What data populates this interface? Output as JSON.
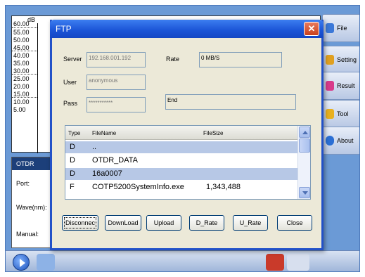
{
  "background": {
    "y_axis": {
      "unit": "dB",
      "ticks": [
        "60.00",
        "55.00",
        "50.00",
        "45.00",
        "40.00",
        "35.00",
        "30.00",
        "25.00",
        "20.00",
        "15.00",
        "10.00",
        "5.00"
      ]
    },
    "side_menu": [
      {
        "label": "File",
        "icon": "folder-icon",
        "color": "#3b78d8"
      },
      {
        "label": "Setting",
        "icon": "settings-icon",
        "color": "#e0a020"
      },
      {
        "label": "Result",
        "icon": "result-icon",
        "color": "#d83a8a"
      },
      {
        "label": "Tool",
        "icon": "tool-icon",
        "color": "#e8b020"
      },
      {
        "label": "About",
        "icon": "info-icon",
        "color": "#2b6fd4"
      }
    ],
    "left_panel": {
      "title": "OTDR",
      "port_label": "Port:",
      "wave_label": "Wave(nm):",
      "manual_label": "Manual:"
    }
  },
  "dialog": {
    "title": "FTP",
    "close_label": "✕",
    "server_label": "Server",
    "server_value": "192.168.001.192",
    "rate_label": "Rate",
    "rate_value": "0 MB/S",
    "user_label": "User",
    "user_value": "anonymous",
    "pass_label": "Pass",
    "pass_value": "***********",
    "status_value": "End",
    "file_list": {
      "columns": [
        "Type",
        "FileName",
        "FileSize"
      ],
      "rows": [
        {
          "type": "D",
          "name": "..",
          "size": ""
        },
        {
          "type": "D",
          "name": "OTDR_DATA",
          "size": ""
        },
        {
          "type": "D",
          "name": "16a0007",
          "size": ""
        },
        {
          "type": "F",
          "name": "COTP5200SystemInfo.exe",
          "size": "1,343,488"
        }
      ]
    },
    "buttons": {
      "disconnect": "Disconnec",
      "download": "DownLoad",
      "upload": "Upload",
      "d_rate": "D_Rate",
      "u_rate": "U_Rate",
      "close": "Close"
    }
  }
}
